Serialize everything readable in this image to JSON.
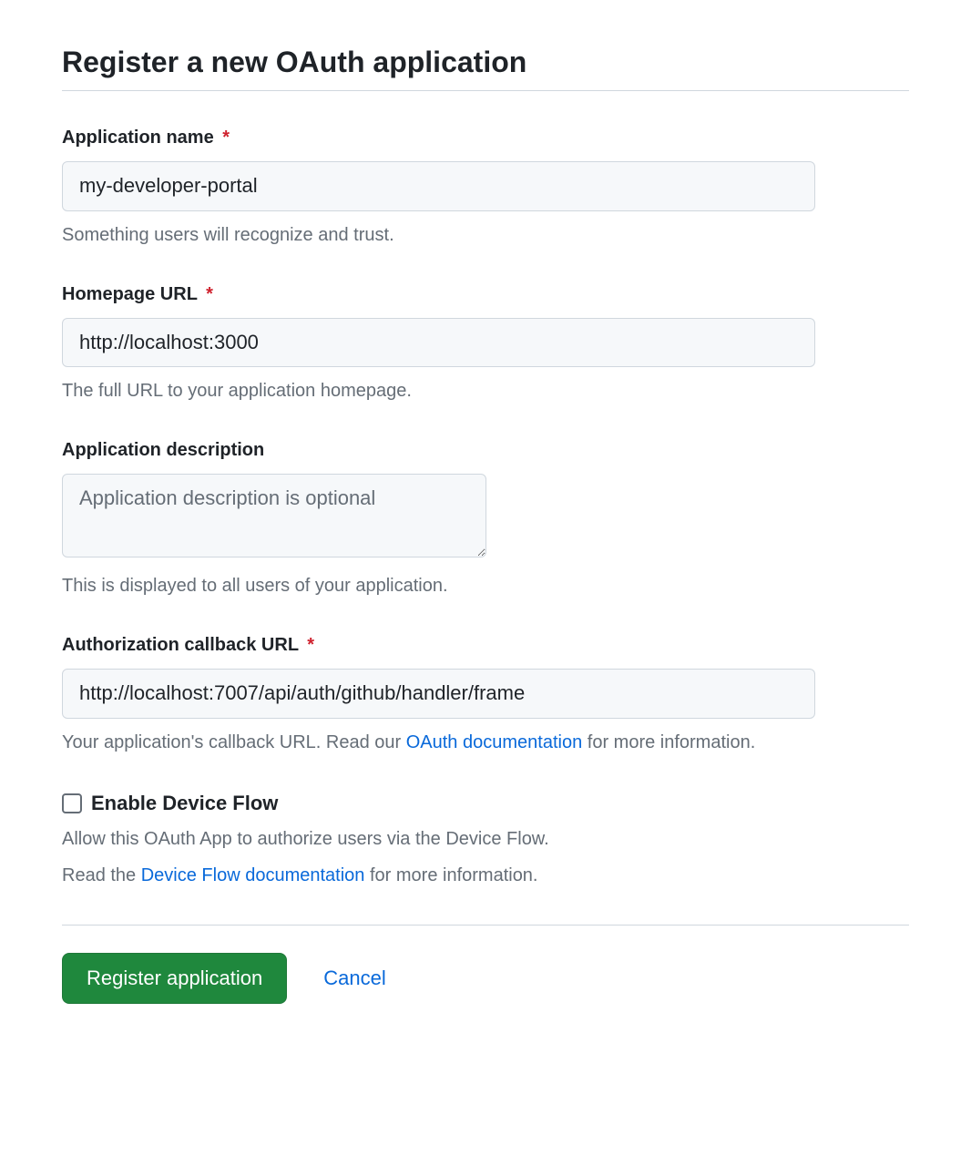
{
  "page": {
    "title": "Register a new OAuth application"
  },
  "fields": {
    "app_name": {
      "label": "Application name",
      "required": true,
      "value": "my-developer-portal",
      "help": "Something users will recognize and trust."
    },
    "homepage_url": {
      "label": "Homepage URL",
      "required": true,
      "value": "http://localhost:3000",
      "help": "The full URL to your application homepage."
    },
    "app_description": {
      "label": "Application description",
      "required": false,
      "value": "",
      "placeholder": "Application description is optional",
      "help": "This is displayed to all users of your application."
    },
    "callback_url": {
      "label": "Authorization callback URL",
      "required": true,
      "value": "http://localhost:7007/api/auth/github/handler/frame",
      "help_prefix": "Your application's callback URL. Read our ",
      "help_link": "OAuth documentation",
      "help_suffix": " for more information."
    },
    "device_flow": {
      "label": "Enable Device Flow",
      "checked": false,
      "help_line1": "Allow this OAuth App to authorize users via the Device Flow.",
      "help_line2_prefix": "Read the ",
      "help_line2_link": "Device Flow documentation",
      "help_line2_suffix": " for more information."
    }
  },
  "buttons": {
    "submit": "Register application",
    "cancel": "Cancel"
  },
  "required_marker": "*"
}
